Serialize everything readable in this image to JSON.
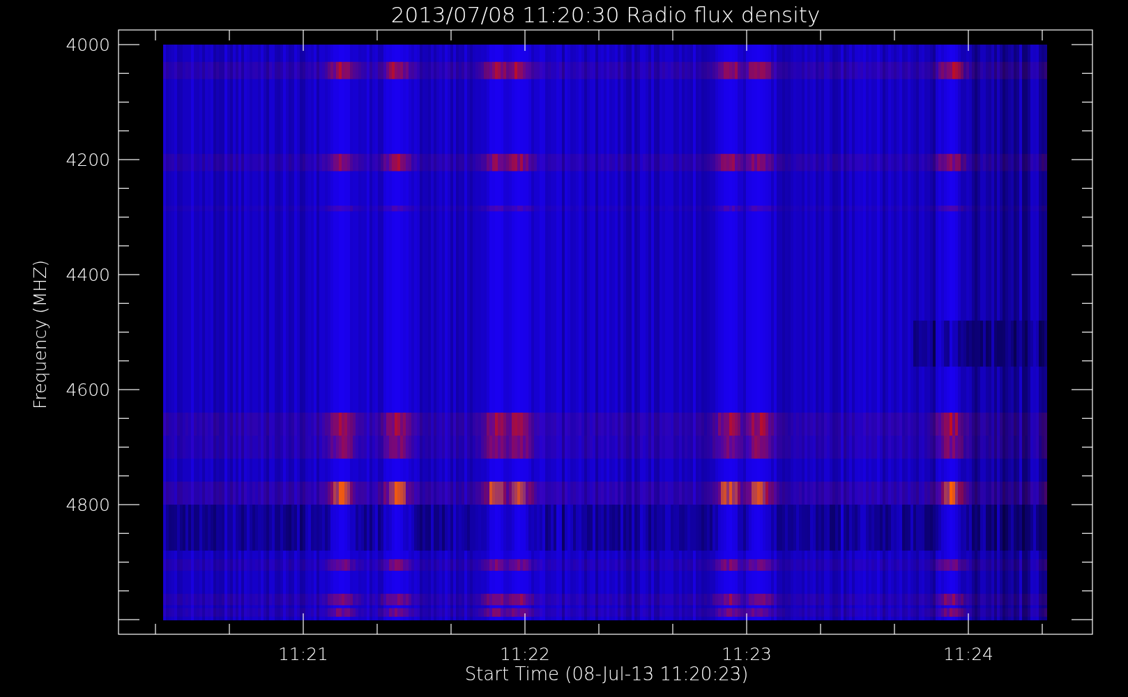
{
  "title": "2013/07/08 11:20:30 Radio flux density",
  "y_axis": {
    "label": "Frequency (MHZ)",
    "ticks": [
      "4000",
      "4200",
      "4400",
      "4600",
      "4800"
    ]
  },
  "x_axis": {
    "label": "Start Time (08-Jul-13 11:20:23)",
    "ticks": [
      "11:21",
      "11:22",
      "11:23",
      "11:24"
    ]
  }
}
